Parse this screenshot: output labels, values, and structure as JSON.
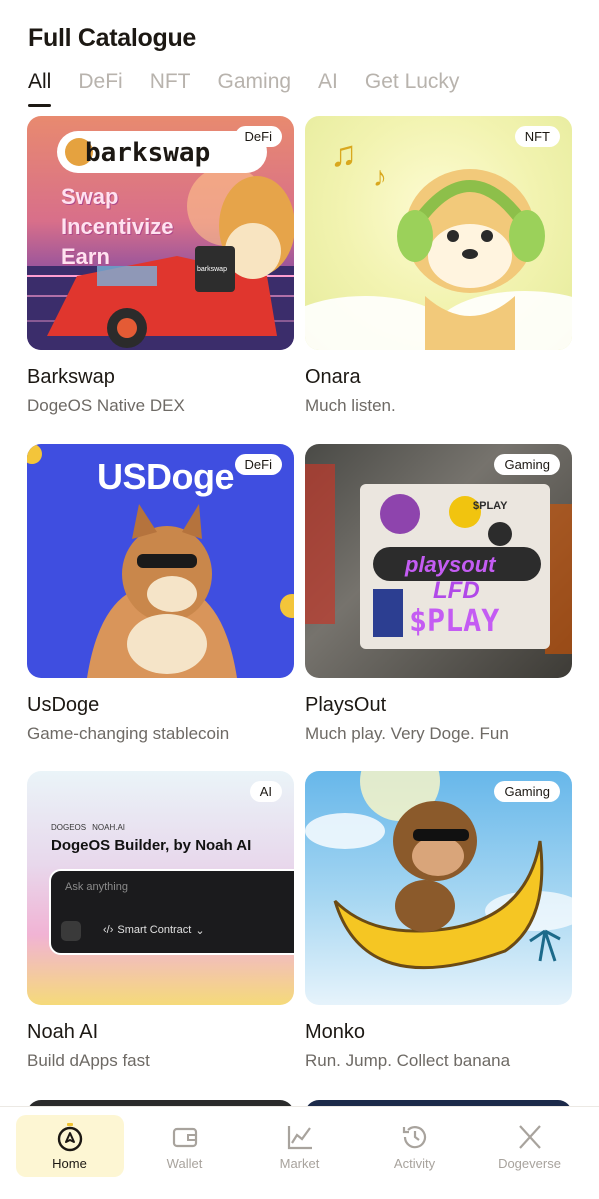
{
  "header": {
    "title": "Full Catalogue"
  },
  "tabs": [
    {
      "label": "All",
      "active": true
    },
    {
      "label": "DeFi",
      "active": false
    },
    {
      "label": "NFT",
      "active": false
    },
    {
      "label": "Gaming",
      "active": false
    },
    {
      "label": "AI",
      "active": false
    },
    {
      "label": "Get Lucky",
      "active": false
    }
  ],
  "cards": [
    {
      "title": "Barkswap",
      "subtitle": "DogeOS Native DEX",
      "badge": "DeFi",
      "art": {
        "logo": "barkswap",
        "lines": [
          "Swap",
          "Incentivize",
          "Earn"
        ],
        "mug": "barkswap"
      }
    },
    {
      "title": "Onara",
      "subtitle": "Much listen.",
      "badge": "NFT"
    },
    {
      "title": "UsDoge",
      "subtitle": "Game-changing stablecoin",
      "badge": "DeFi",
      "art": {
        "logo": "USDoge"
      }
    },
    {
      "title": "PlaysOut",
      "subtitle": "Much play. Very Doge. Fun",
      "badge": "Gaming",
      "art": {
        "sticker1": "playsout",
        "sticker2": "LFD",
        "sticker3": "$PLAY",
        "sticker4": "$PLAY"
      }
    },
    {
      "title": "Noah AI",
      "subtitle": "Build dApps fast",
      "badge": "AI",
      "art": {
        "brand_left": "DOGEOS",
        "brand_right": "NOAH.AI",
        "heading": "DogeOS Builder, by Noah AI",
        "input_placeholder": "Ask anything",
        "mode_label": "Smart Contract"
      }
    },
    {
      "title": "Monko",
      "subtitle": "Run. Jump. Collect banana",
      "badge": "Gaming"
    }
  ],
  "bottom_nav": [
    {
      "label": "Home",
      "icon": "home-icon",
      "active": true
    },
    {
      "label": "Wallet",
      "icon": "wallet-icon",
      "active": false
    },
    {
      "label": "Market",
      "icon": "market-icon",
      "active": false
    },
    {
      "label": "Activity",
      "icon": "activity-icon",
      "active": false
    },
    {
      "label": "Dogeverse",
      "icon": "x-icon",
      "active": false
    }
  ],
  "colors": {
    "accent_bg": "#fdf6d3",
    "text": "#1c1813",
    "muted": "#b8b3ad"
  }
}
